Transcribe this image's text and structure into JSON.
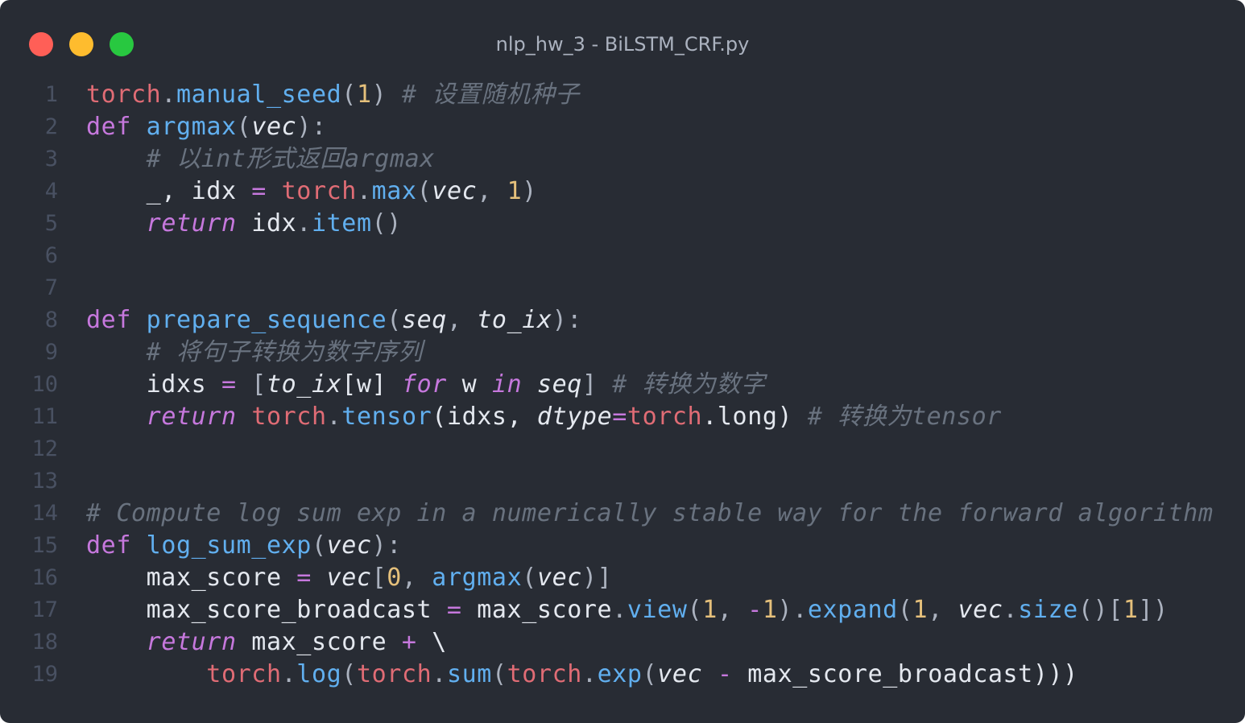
{
  "window": {
    "title": "nlp_hw_3 - BiLSTM_CRF.py",
    "controls": {
      "close_color": "#ff5f57",
      "minimize_color": "#febc2e",
      "maximize_color": "#28c840"
    }
  },
  "editor": {
    "language": "python",
    "theme_colors": {
      "background": "#282c34",
      "keyword": "#c678dd",
      "function": "#61afef",
      "module": "#e06c75",
      "number": "#e5c07b",
      "comment": "#69727f",
      "text": "#e4e8ef"
    },
    "lines": [
      {
        "number": "1",
        "tokens": [
          {
            "t": "torch",
            "k": "mod"
          },
          {
            "t": ".",
            "k": "pun"
          },
          {
            "t": "manual_seed",
            "k": "fn"
          },
          {
            "t": "(",
            "k": "pun"
          },
          {
            "t": "1",
            "k": "num"
          },
          {
            "t": ")",
            "k": "pun"
          },
          {
            "t": " ",
            "k": "txt"
          },
          {
            "t": "# 设置随机种子",
            "k": "cm"
          }
        ]
      },
      {
        "number": "2",
        "tokens": [
          {
            "t": "def",
            "k": "kw"
          },
          {
            "t": " ",
            "k": "txt"
          },
          {
            "t": "argmax",
            "k": "fn"
          },
          {
            "t": "(",
            "k": "pun"
          },
          {
            "t": "vec",
            "k": "par"
          },
          {
            "t": "):",
            "k": "pun"
          }
        ]
      },
      {
        "number": "3",
        "tokens": [
          {
            "t": "    ",
            "k": "txt"
          },
          {
            "t": "# 以int形式返回argmax",
            "k": "cm"
          }
        ]
      },
      {
        "number": "4",
        "tokens": [
          {
            "t": "    _, idx ",
            "k": "txt"
          },
          {
            "t": "=",
            "k": "op"
          },
          {
            "t": " ",
            "k": "txt"
          },
          {
            "t": "torch",
            "k": "mod"
          },
          {
            "t": ".",
            "k": "pun"
          },
          {
            "t": "max",
            "k": "fn"
          },
          {
            "t": "(",
            "k": "pun"
          },
          {
            "t": "vec",
            "k": "par"
          },
          {
            "t": ", ",
            "k": "pun"
          },
          {
            "t": "1",
            "k": "num"
          },
          {
            "t": ")",
            "k": "pun"
          }
        ]
      },
      {
        "number": "5",
        "tokens": [
          {
            "t": "    ",
            "k": "txt"
          },
          {
            "t": "return",
            "k": "kwi"
          },
          {
            "t": " idx",
            "k": "txt"
          },
          {
            "t": ".",
            "k": "pun"
          },
          {
            "t": "item",
            "k": "fn"
          },
          {
            "t": "()",
            "k": "pun"
          }
        ]
      },
      {
        "number": "6",
        "tokens": []
      },
      {
        "number": "7",
        "tokens": []
      },
      {
        "number": "8",
        "tokens": [
          {
            "t": "def",
            "k": "kw"
          },
          {
            "t": " ",
            "k": "txt"
          },
          {
            "t": "prepare_sequence",
            "k": "fn"
          },
          {
            "t": "(",
            "k": "pun"
          },
          {
            "t": "seq",
            "k": "par"
          },
          {
            "t": ", ",
            "k": "pun"
          },
          {
            "t": "to_ix",
            "k": "par"
          },
          {
            "t": "):",
            "k": "pun"
          }
        ]
      },
      {
        "number": "9",
        "tokens": [
          {
            "t": "    ",
            "k": "txt"
          },
          {
            "t": "# 将句子转换为数字序列",
            "k": "cm"
          }
        ]
      },
      {
        "number": "10",
        "tokens": [
          {
            "t": "    idxs ",
            "k": "txt"
          },
          {
            "t": "=",
            "k": "op"
          },
          {
            "t": " [",
            "k": "pun"
          },
          {
            "t": "to_ix",
            "k": "par"
          },
          {
            "t": "[w] ",
            "k": "txt"
          },
          {
            "t": "for",
            "k": "kwi"
          },
          {
            "t": " w ",
            "k": "txt"
          },
          {
            "t": "in",
            "k": "kwi"
          },
          {
            "t": " ",
            "k": "txt"
          },
          {
            "t": "seq",
            "k": "par"
          },
          {
            "t": "] ",
            "k": "pun"
          },
          {
            "t": "# 转换为数字",
            "k": "cm"
          }
        ]
      },
      {
        "number": "11",
        "tokens": [
          {
            "t": "    ",
            "k": "txt"
          },
          {
            "t": "return",
            "k": "kwi"
          },
          {
            "t": " ",
            "k": "txt"
          },
          {
            "t": "torch",
            "k": "mod"
          },
          {
            "t": ".",
            "k": "pun"
          },
          {
            "t": "tensor",
            "k": "fn"
          },
          {
            "t": "(idxs, ",
            "k": "txt"
          },
          {
            "t": "dtype",
            "k": "par"
          },
          {
            "t": "=",
            "k": "op"
          },
          {
            "t": "torch",
            "k": "mod"
          },
          {
            "t": ".long) ",
            "k": "txt"
          },
          {
            "t": "# 转换为tensor",
            "k": "cm"
          }
        ]
      },
      {
        "number": "12",
        "tokens": []
      },
      {
        "number": "13",
        "tokens": []
      },
      {
        "number": "14",
        "tokens": [
          {
            "t": "# Compute log sum exp in a numerically stable way for the forward algorithm",
            "k": "cm"
          }
        ]
      },
      {
        "number": "15",
        "tokens": [
          {
            "t": "def",
            "k": "kw"
          },
          {
            "t": " ",
            "k": "txt"
          },
          {
            "t": "log_sum_exp",
            "k": "fn"
          },
          {
            "t": "(",
            "k": "pun"
          },
          {
            "t": "vec",
            "k": "par"
          },
          {
            "t": "):",
            "k": "pun"
          }
        ]
      },
      {
        "number": "16",
        "tokens": [
          {
            "t": "    max_score ",
            "k": "txt"
          },
          {
            "t": "=",
            "k": "op"
          },
          {
            "t": " ",
            "k": "txt"
          },
          {
            "t": "vec",
            "k": "par"
          },
          {
            "t": "[",
            "k": "pun"
          },
          {
            "t": "0",
            "k": "num"
          },
          {
            "t": ", ",
            "k": "pun"
          },
          {
            "t": "argmax",
            "k": "fn"
          },
          {
            "t": "(",
            "k": "pun"
          },
          {
            "t": "vec",
            "k": "par"
          },
          {
            "t": ")]",
            "k": "pun"
          }
        ]
      },
      {
        "number": "17",
        "tokens": [
          {
            "t": "    max_score_broadcast ",
            "k": "txt"
          },
          {
            "t": "=",
            "k": "op"
          },
          {
            "t": " max_score",
            "k": "txt"
          },
          {
            "t": ".",
            "k": "pun"
          },
          {
            "t": "view",
            "k": "fn"
          },
          {
            "t": "(",
            "k": "pun"
          },
          {
            "t": "1",
            "k": "num"
          },
          {
            "t": ", ",
            "k": "pun"
          },
          {
            "t": "-",
            "k": "op"
          },
          {
            "t": "1",
            "k": "num"
          },
          {
            "t": ").",
            "k": "pun"
          },
          {
            "t": "expand",
            "k": "fn"
          },
          {
            "t": "(",
            "k": "pun"
          },
          {
            "t": "1",
            "k": "num"
          },
          {
            "t": ", ",
            "k": "pun"
          },
          {
            "t": "vec",
            "k": "par"
          },
          {
            "t": ".",
            "k": "pun"
          },
          {
            "t": "size",
            "k": "fn"
          },
          {
            "t": "()[",
            "k": "pun"
          },
          {
            "t": "1",
            "k": "num"
          },
          {
            "t": "])",
            "k": "pun"
          }
        ]
      },
      {
        "number": "18",
        "tokens": [
          {
            "t": "    ",
            "k": "txt"
          },
          {
            "t": "return",
            "k": "kwi"
          },
          {
            "t": " max_score ",
            "k": "txt"
          },
          {
            "t": "+",
            "k": "op"
          },
          {
            "t": " \\",
            "k": "txt"
          }
        ]
      },
      {
        "number": "19",
        "tokens": [
          {
            "t": "        ",
            "k": "txt"
          },
          {
            "t": "torch",
            "k": "mod"
          },
          {
            "t": ".",
            "k": "pun"
          },
          {
            "t": "log",
            "k": "fn"
          },
          {
            "t": "(",
            "k": "pun"
          },
          {
            "t": "torch",
            "k": "mod"
          },
          {
            "t": ".",
            "k": "pun"
          },
          {
            "t": "sum",
            "k": "fn"
          },
          {
            "t": "(",
            "k": "pun"
          },
          {
            "t": "torch",
            "k": "mod"
          },
          {
            "t": ".",
            "k": "pun"
          },
          {
            "t": "exp",
            "k": "fn"
          },
          {
            "t": "(",
            "k": "pun"
          },
          {
            "t": "vec",
            "k": "par"
          },
          {
            "t": " ",
            "k": "txt"
          },
          {
            "t": "-",
            "k": "op"
          },
          {
            "t": " max_score_broadcast)))",
            "k": "txt"
          }
        ]
      }
    ]
  }
}
